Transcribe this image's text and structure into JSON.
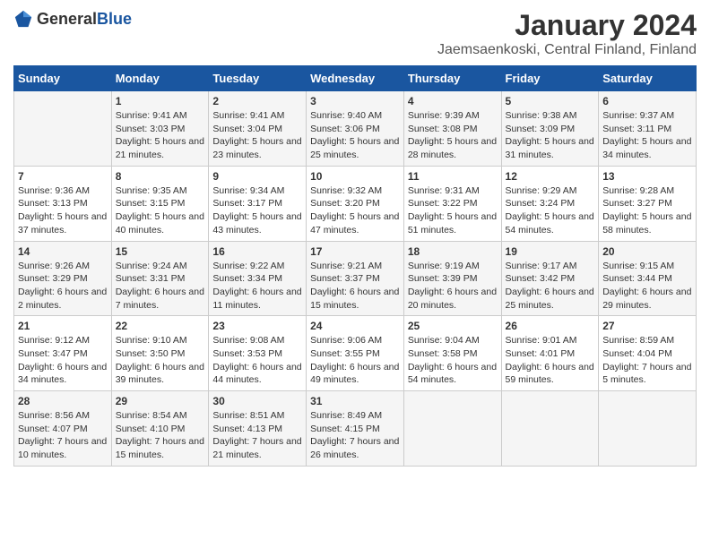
{
  "header": {
    "logo_general": "General",
    "logo_blue": "Blue",
    "month": "January 2024",
    "location": "Jaemsaenkoski, Central Finland, Finland"
  },
  "days_of_week": [
    "Sunday",
    "Monday",
    "Tuesday",
    "Wednesday",
    "Thursday",
    "Friday",
    "Saturday"
  ],
  "weeks": [
    [
      {
        "day": "",
        "sunrise": "",
        "sunset": "",
        "daylight": ""
      },
      {
        "day": "1",
        "sunrise": "Sunrise: 9:41 AM",
        "sunset": "Sunset: 3:03 PM",
        "daylight": "Daylight: 5 hours and 21 minutes."
      },
      {
        "day": "2",
        "sunrise": "Sunrise: 9:41 AM",
        "sunset": "Sunset: 3:04 PM",
        "daylight": "Daylight: 5 hours and 23 minutes."
      },
      {
        "day": "3",
        "sunrise": "Sunrise: 9:40 AM",
        "sunset": "Sunset: 3:06 PM",
        "daylight": "Daylight: 5 hours and 25 minutes."
      },
      {
        "day": "4",
        "sunrise": "Sunrise: 9:39 AM",
        "sunset": "Sunset: 3:08 PM",
        "daylight": "Daylight: 5 hours and 28 minutes."
      },
      {
        "day": "5",
        "sunrise": "Sunrise: 9:38 AM",
        "sunset": "Sunset: 3:09 PM",
        "daylight": "Daylight: 5 hours and 31 minutes."
      },
      {
        "day": "6",
        "sunrise": "Sunrise: 9:37 AM",
        "sunset": "Sunset: 3:11 PM",
        "daylight": "Daylight: 5 hours and 34 minutes."
      }
    ],
    [
      {
        "day": "7",
        "sunrise": "Sunrise: 9:36 AM",
        "sunset": "Sunset: 3:13 PM",
        "daylight": "Daylight: 5 hours and 37 minutes."
      },
      {
        "day": "8",
        "sunrise": "Sunrise: 9:35 AM",
        "sunset": "Sunset: 3:15 PM",
        "daylight": "Daylight: 5 hours and 40 minutes."
      },
      {
        "day": "9",
        "sunrise": "Sunrise: 9:34 AM",
        "sunset": "Sunset: 3:17 PM",
        "daylight": "Daylight: 5 hours and 43 minutes."
      },
      {
        "day": "10",
        "sunrise": "Sunrise: 9:32 AM",
        "sunset": "Sunset: 3:20 PM",
        "daylight": "Daylight: 5 hours and 47 minutes."
      },
      {
        "day": "11",
        "sunrise": "Sunrise: 9:31 AM",
        "sunset": "Sunset: 3:22 PM",
        "daylight": "Daylight: 5 hours and 51 minutes."
      },
      {
        "day": "12",
        "sunrise": "Sunrise: 9:29 AM",
        "sunset": "Sunset: 3:24 PM",
        "daylight": "Daylight: 5 hours and 54 minutes."
      },
      {
        "day": "13",
        "sunrise": "Sunrise: 9:28 AM",
        "sunset": "Sunset: 3:27 PM",
        "daylight": "Daylight: 5 hours and 58 minutes."
      }
    ],
    [
      {
        "day": "14",
        "sunrise": "Sunrise: 9:26 AM",
        "sunset": "Sunset: 3:29 PM",
        "daylight": "Daylight: 6 hours and 2 minutes."
      },
      {
        "day": "15",
        "sunrise": "Sunrise: 9:24 AM",
        "sunset": "Sunset: 3:31 PM",
        "daylight": "Daylight: 6 hours and 7 minutes."
      },
      {
        "day": "16",
        "sunrise": "Sunrise: 9:22 AM",
        "sunset": "Sunset: 3:34 PM",
        "daylight": "Daylight: 6 hours and 11 minutes."
      },
      {
        "day": "17",
        "sunrise": "Sunrise: 9:21 AM",
        "sunset": "Sunset: 3:37 PM",
        "daylight": "Daylight: 6 hours and 15 minutes."
      },
      {
        "day": "18",
        "sunrise": "Sunrise: 9:19 AM",
        "sunset": "Sunset: 3:39 PM",
        "daylight": "Daylight: 6 hours and 20 minutes."
      },
      {
        "day": "19",
        "sunrise": "Sunrise: 9:17 AM",
        "sunset": "Sunset: 3:42 PM",
        "daylight": "Daylight: 6 hours and 25 minutes."
      },
      {
        "day": "20",
        "sunrise": "Sunrise: 9:15 AM",
        "sunset": "Sunset: 3:44 PM",
        "daylight": "Daylight: 6 hours and 29 minutes."
      }
    ],
    [
      {
        "day": "21",
        "sunrise": "Sunrise: 9:12 AM",
        "sunset": "Sunset: 3:47 PM",
        "daylight": "Daylight: 6 hours and 34 minutes."
      },
      {
        "day": "22",
        "sunrise": "Sunrise: 9:10 AM",
        "sunset": "Sunset: 3:50 PM",
        "daylight": "Daylight: 6 hours and 39 minutes."
      },
      {
        "day": "23",
        "sunrise": "Sunrise: 9:08 AM",
        "sunset": "Sunset: 3:53 PM",
        "daylight": "Daylight: 6 hours and 44 minutes."
      },
      {
        "day": "24",
        "sunrise": "Sunrise: 9:06 AM",
        "sunset": "Sunset: 3:55 PM",
        "daylight": "Daylight: 6 hours and 49 minutes."
      },
      {
        "day": "25",
        "sunrise": "Sunrise: 9:04 AM",
        "sunset": "Sunset: 3:58 PM",
        "daylight": "Daylight: 6 hours and 54 minutes."
      },
      {
        "day": "26",
        "sunrise": "Sunrise: 9:01 AM",
        "sunset": "Sunset: 4:01 PM",
        "daylight": "Daylight: 6 hours and 59 minutes."
      },
      {
        "day": "27",
        "sunrise": "Sunrise: 8:59 AM",
        "sunset": "Sunset: 4:04 PM",
        "daylight": "Daylight: 7 hours and 5 minutes."
      }
    ],
    [
      {
        "day": "28",
        "sunrise": "Sunrise: 8:56 AM",
        "sunset": "Sunset: 4:07 PM",
        "daylight": "Daylight: 7 hours and 10 minutes."
      },
      {
        "day": "29",
        "sunrise": "Sunrise: 8:54 AM",
        "sunset": "Sunset: 4:10 PM",
        "daylight": "Daylight: 7 hours and 15 minutes."
      },
      {
        "day": "30",
        "sunrise": "Sunrise: 8:51 AM",
        "sunset": "Sunset: 4:13 PM",
        "daylight": "Daylight: 7 hours and 21 minutes."
      },
      {
        "day": "31",
        "sunrise": "Sunrise: 8:49 AM",
        "sunset": "Sunset: 4:15 PM",
        "daylight": "Daylight: 7 hours and 26 minutes."
      },
      {
        "day": "",
        "sunrise": "",
        "sunset": "",
        "daylight": ""
      },
      {
        "day": "",
        "sunrise": "",
        "sunset": "",
        "daylight": ""
      },
      {
        "day": "",
        "sunrise": "",
        "sunset": "",
        "daylight": ""
      }
    ]
  ]
}
